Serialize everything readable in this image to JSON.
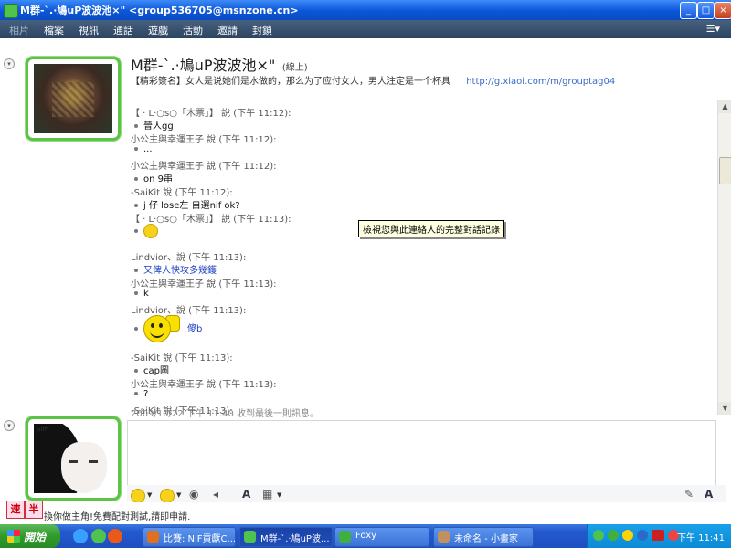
{
  "window": {
    "title": "M群-`.·鳩uP波波池×\" <group536705@msnzone.cn>",
    "buttons": {
      "minimize": "_",
      "maximize": "□",
      "close": "×"
    }
  },
  "menu": {
    "items": [
      "相片",
      "檔案",
      "視訊",
      "通話",
      "遊戲",
      "活動",
      "邀請",
      "封鎖"
    ],
    "options_icon": "menu-options-icon"
  },
  "contact": {
    "name": "M群-`.·鳩uP波波池×\"",
    "status": "(線上)",
    "signature": "【精彩簽名】女人是说她们是水做的，那么为了应付女人，男人注定是一个杯具",
    "link": "http://g.xiaoi.com/m/grouptag04"
  },
  "conversation": [
    {
      "kind": "speaker",
      "text": "【 · L·○s○「木票」】 說 (下午 11:12):"
    },
    {
      "kind": "msg",
      "text": "晉人gg"
    },
    {
      "kind": "speaker",
      "text": "小公主與幸運王子 說 (下午 11:12):"
    },
    {
      "kind": "msg",
      "text": "..."
    },
    {
      "kind": "speaker",
      "text": "小公主與幸運王子 說 (下午 11:12):"
    },
    {
      "kind": "msg",
      "text": "on 9串"
    },
    {
      "kind": "speaker",
      "text": "-SaiKit 說 (下午 11:12):"
    },
    {
      "kind": "msg",
      "text": "j 仔 lose左 自選nif ok?"
    },
    {
      "kind": "speaker",
      "text": "【 · L·○s○「木票」】 說 (下午 11:13):"
    },
    {
      "kind": "msg-emoji",
      "text": ""
    },
    {
      "kind": "speaker",
      "text": "Lindvior、說 (下午 11:13):"
    },
    {
      "kind": "msg-blue",
      "text": "又俾人快攻多幾鑊"
    },
    {
      "kind": "speaker",
      "text": "小公主與幸運王子 說 (下午 11:13):"
    },
    {
      "kind": "msg",
      "text": "k"
    },
    {
      "kind": "speaker",
      "text": "Lindvior、說 (下午 11:13):"
    },
    {
      "kind": "msg-bigemoji",
      "text": "傻b"
    },
    {
      "kind": "speaker",
      "text": "-SaiKit 說 (下午 11:13):"
    },
    {
      "kind": "msg",
      "text": "cap圖"
    },
    {
      "kind": "speaker",
      "text": "小公主與幸運王子 說 (下午 11:13):"
    },
    {
      "kind": "msg",
      "text": "?"
    },
    {
      "kind": "speaker",
      "text": "-SaiKit 說 (下午 11:13):"
    },
    {
      "kind": "msg",
      "text": "-丶ヾヾ                         º×kIt______` 說:"
    }
  ],
  "last_message": "2009/10/22 下午 11:40 收到最後一則訊息。",
  "tooltip": "檢視您與此連絡人的完整對話記錄",
  "self_avatar_tag": "Sim",
  "ad": {
    "btn1": "速",
    "btn2": "半",
    "text": "換你做主角!免費配對測試,請即申請."
  },
  "taskbar": {
    "start": "開始",
    "tasks": [
      {
        "label": "比賽: NiF貢獻C...",
        "color": "#e07020"
      },
      {
        "label": "M群-`.·鳩uP波...",
        "color": "#4fc24f",
        "active": true
      },
      {
        "label": "Foxy",
        "color": "#3fb03f"
      },
      {
        "label": "未命名 - 小畫家",
        "color": "#c09060"
      }
    ],
    "clock": "下午 11:41"
  },
  "colors": {
    "accent": "#0b56d8",
    "frame": "#5bc543",
    "link": "#3a6ac8"
  }
}
